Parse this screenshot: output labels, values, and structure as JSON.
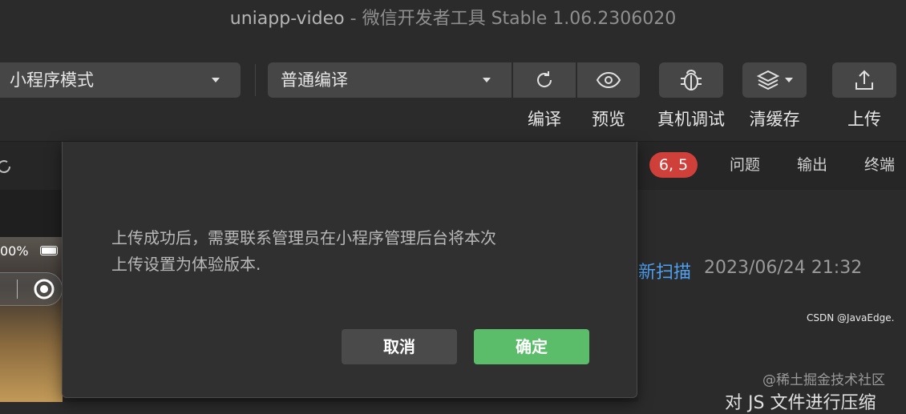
{
  "window": {
    "project": "uniapp-video",
    "separator": " - ",
    "app_title": "微信开发者工具 Stable 1.06.2306020"
  },
  "toolbar": {
    "mode_select": "小程序模式",
    "compile_select": "普通编译",
    "buttons": [
      {
        "icon": "refresh-icon",
        "label": "编译"
      },
      {
        "icon": "eye-icon",
        "label": "预览"
      },
      {
        "icon": "bug-icon",
        "label": "真机调试"
      },
      {
        "icon": "layers-icon",
        "label": "清缓存"
      },
      {
        "icon": "upload-icon",
        "label": "上传"
      }
    ]
  },
  "panel": {
    "badge": "6, 5",
    "tabs": [
      "问题",
      "输出",
      "终端"
    ]
  },
  "simulator": {
    "battery_text": "00%"
  },
  "right_content": {
    "rescan_link": "新扫描",
    "timestamp": "2023/06/24 21:32",
    "bottom_text": "对 JS 文件进行压缩",
    "watermark_small": "CSDN @JavaEdge.",
    "watermark_large": "@稀土掘金技术社区"
  },
  "dialog": {
    "message_line1": "上传成功后，需要联系管理员在小程序管理后台将本次",
    "message_line2": "上传设置为体验版本.",
    "cancel_label": "取消",
    "confirm_label": "确定"
  },
  "colors": {
    "accent_green": "#5bbd6a",
    "badge_red": "#d0403a",
    "link_blue": "#4ea1f3"
  }
}
